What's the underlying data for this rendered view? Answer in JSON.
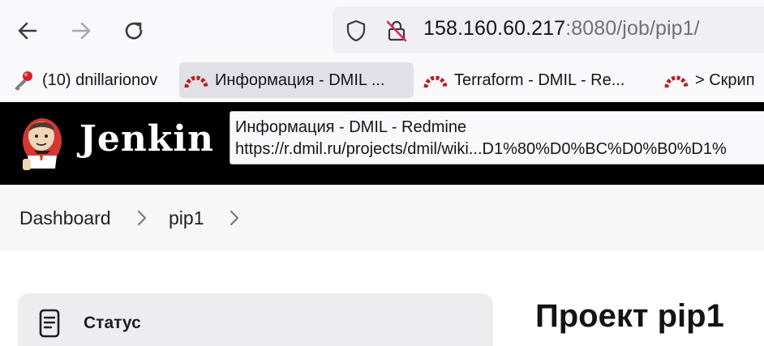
{
  "browser": {
    "url": {
      "host": "158.160.60.217",
      "path": ":8080/job/pip1/"
    },
    "nav": {
      "back_icon": "back-arrow-icon",
      "forward_icon": "forward-arrow-icon",
      "reload_icon": "reload-icon"
    },
    "bookmarks": [
      {
        "label": "(10) dnillarionov",
        "icon": "key-icon"
      },
      {
        "label": "Информация - DMIL ...",
        "icon": "redmine-icon"
      },
      {
        "label": "Terraform - DMIL - Re...",
        "icon": "redmine-icon"
      },
      {
        "label": "> Скрип",
        "icon": "redmine-icon"
      }
    ],
    "tooltip": {
      "title": "Информация - DMIL - Redmine",
      "url": "https://r.dmil.ru/projects/dmil/wiki...D1%80%D0%BC%D0%B0%D1%"
    }
  },
  "jenkins": {
    "title": "Jenkin",
    "breadcrumb": [
      "Dashboard",
      "pip1"
    ],
    "sidebar": {
      "status_label": "Статус"
    },
    "project_title": "Проект pip1"
  },
  "colors": {
    "header_bg": "#000000",
    "redmine_red": "#b32024",
    "breadcrumb_bg": "#f7f7f8"
  }
}
